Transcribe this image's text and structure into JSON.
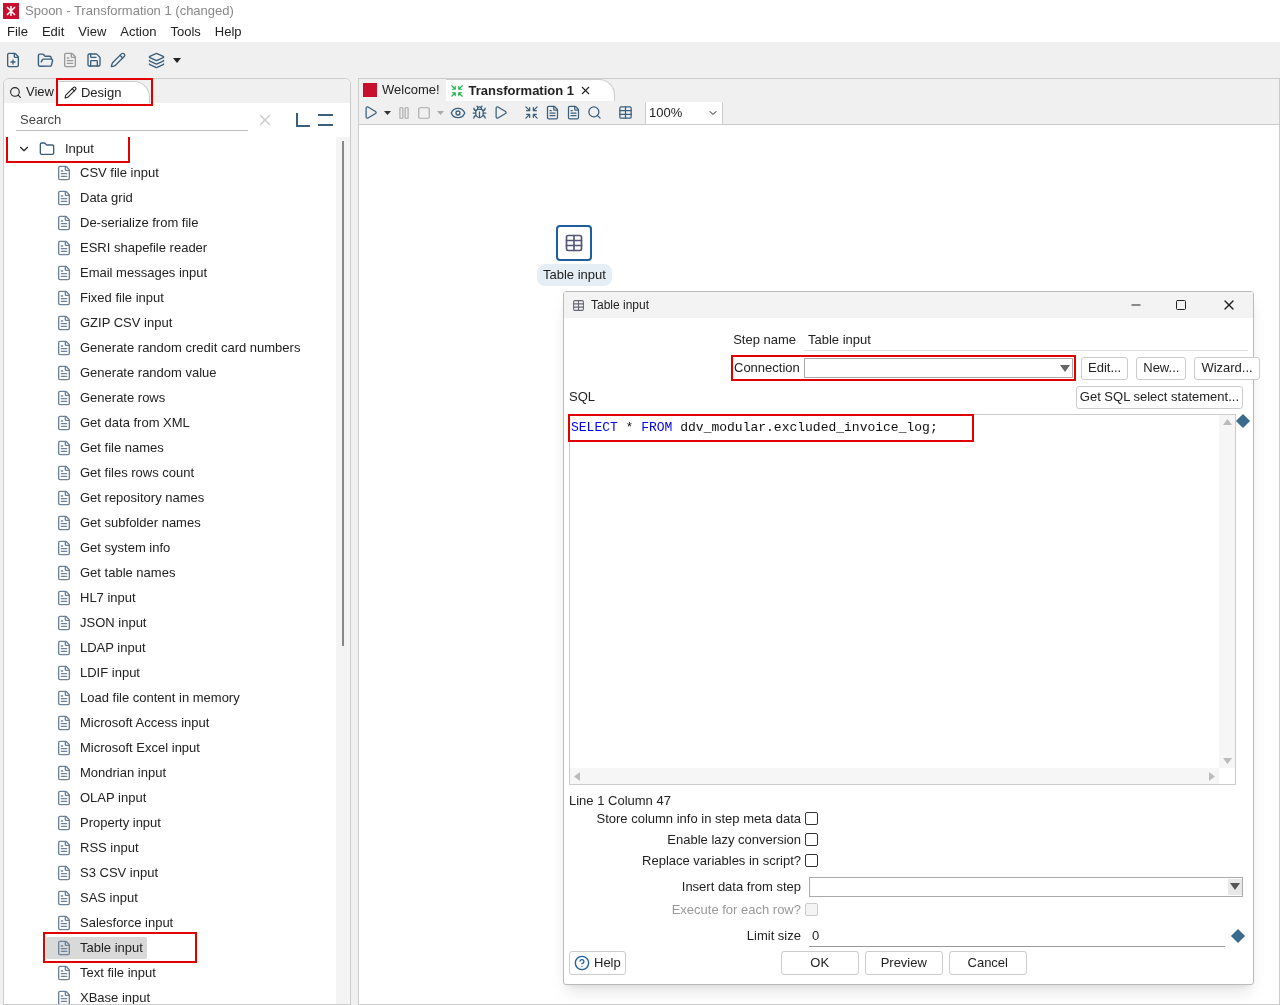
{
  "window": {
    "title": "Spoon - Transformation 1 (changed)"
  },
  "menu": [
    "File",
    "Edit",
    "View",
    "Action",
    "Tools",
    "Help"
  ],
  "left_panel": {
    "tabs": [
      {
        "label": "View",
        "selected": false,
        "annotated": false
      },
      {
        "label": "Design",
        "selected": true,
        "annotated": true
      }
    ],
    "search": {
      "placeholder": "Search"
    },
    "tree": [
      {
        "label": "Input",
        "expanded": true,
        "annotated": true,
        "children": [
          {
            "label": "CSV file input",
            "selected": false,
            "annotated": false
          },
          {
            "label": "Data grid",
            "selected": false,
            "annotated": false
          },
          {
            "label": "De-serialize from file",
            "selected": false,
            "annotated": false
          },
          {
            "label": "ESRI shapefile reader",
            "selected": false,
            "annotated": false
          },
          {
            "label": "Email messages input",
            "selected": false,
            "annotated": false
          },
          {
            "label": "Fixed file input",
            "selected": false,
            "annotated": false
          },
          {
            "label": "GZIP CSV input",
            "selected": false,
            "annotated": false
          },
          {
            "label": "Generate random credit card numbers",
            "selected": false,
            "annotated": false
          },
          {
            "label": "Generate random value",
            "selected": false,
            "annotated": false
          },
          {
            "label": "Generate rows",
            "selected": false,
            "annotated": false
          },
          {
            "label": "Get data from XML",
            "selected": false,
            "annotated": false
          },
          {
            "label": "Get file names",
            "selected": false,
            "annotated": false
          },
          {
            "label": "Get files rows count",
            "selected": false,
            "annotated": false
          },
          {
            "label": "Get repository names",
            "selected": false,
            "annotated": false
          },
          {
            "label": "Get subfolder names",
            "selected": false,
            "annotated": false
          },
          {
            "label": "Get system info",
            "selected": false,
            "annotated": false
          },
          {
            "label": "Get table names",
            "selected": false,
            "annotated": false
          },
          {
            "label": "HL7 input",
            "selected": false,
            "annotated": false
          },
          {
            "label": "JSON input",
            "selected": false,
            "annotated": false
          },
          {
            "label": "LDAP input",
            "selected": false,
            "annotated": false
          },
          {
            "label": "LDIF input",
            "selected": false,
            "annotated": false
          },
          {
            "label": "Load file content in memory",
            "selected": false,
            "annotated": false
          },
          {
            "label": "Microsoft Access input",
            "selected": false,
            "annotated": false
          },
          {
            "label": "Microsoft Excel input",
            "selected": false,
            "annotated": false
          },
          {
            "label": "Mondrian input",
            "selected": false,
            "annotated": false
          },
          {
            "label": "OLAP input",
            "selected": false,
            "annotated": false
          },
          {
            "label": "Property input",
            "selected": false,
            "annotated": false
          },
          {
            "label": "RSS input",
            "selected": false,
            "annotated": false
          },
          {
            "label": "S3 CSV input",
            "selected": false,
            "annotated": false
          },
          {
            "label": "SAS input",
            "selected": false,
            "annotated": false
          },
          {
            "label": "Salesforce input",
            "selected": false,
            "annotated": false
          },
          {
            "label": "Table input",
            "selected": true,
            "annotated": true
          },
          {
            "label": "Text file input",
            "selected": false,
            "annotated": false
          },
          {
            "label": "XBase input",
            "selected": false,
            "annotated": false
          }
        ]
      }
    ]
  },
  "editor_tabs": [
    {
      "label": "Welcome!",
      "selected": false,
      "closable": false
    },
    {
      "label": "Transformation 1",
      "selected": true,
      "closable": true
    }
  ],
  "zoom": "100%",
  "canvas": {
    "step": {
      "label": "Table input"
    }
  },
  "dialog": {
    "title": "Table input",
    "step_name": {
      "label": "Step name",
      "value": "Table input"
    },
    "connection": {
      "label": "Connection",
      "annotated": true
    },
    "connection_buttons": [
      "Edit...",
      "New...",
      "Wizard..."
    ],
    "sql_label": "SQL",
    "get_sql_button": "Get SQL select statement...",
    "sql": {
      "annotated": true,
      "tokens": [
        {
          "text": "SELECT",
          "kind": "keyword"
        },
        {
          "text": " * ",
          "kind": "plain"
        },
        {
          "text": "FROM",
          "kind": "keyword"
        },
        {
          "text": " ddv_modular.excluded_invoice_log;",
          "kind": "plain"
        }
      ]
    },
    "cursor_position": "Line 1 Column 47",
    "fields": [
      {
        "kind": "checkbox",
        "label": "Store column info in step meta data",
        "checked": false,
        "disabled": false
      },
      {
        "kind": "checkbox",
        "label": "Enable lazy conversion",
        "checked": false,
        "disabled": false
      },
      {
        "kind": "checkbox",
        "label": "Replace variables in script?",
        "checked": false,
        "disabled": false
      },
      {
        "kind": "dropdown",
        "label": "Insert data from step",
        "disabled": false
      },
      {
        "kind": "checkbox",
        "label": "Execute for each row?",
        "checked": false,
        "disabled": true
      },
      {
        "kind": "text",
        "label": "Limit size",
        "value": "0"
      }
    ],
    "help_button": "Help",
    "buttons": [
      "OK",
      "Preview",
      "Cancel"
    ]
  }
}
